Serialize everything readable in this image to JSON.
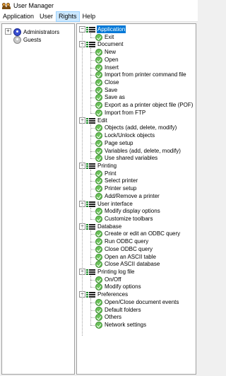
{
  "window": {
    "title": "User Manager"
  },
  "menu": [
    {
      "label": "Application",
      "active": false
    },
    {
      "label": "User",
      "active": false
    },
    {
      "label": "Rights",
      "active": true
    },
    {
      "label": "Help",
      "active": false
    }
  ],
  "users": [
    {
      "label": "Administrators",
      "type": "admin"
    },
    {
      "label": "Guests",
      "type": "guest"
    }
  ],
  "rights": [
    {
      "group": "Application",
      "selected": true,
      "items": [
        "Exit"
      ]
    },
    {
      "group": "Document",
      "items": [
        "New",
        "Open",
        "Insert",
        "Import from printer command file",
        "Close",
        "Save",
        "Save as",
        "Export as a printer object file (POF)",
        "Import from FTP"
      ]
    },
    {
      "group": "Edit",
      "items": [
        "Objects (add, delete, modify)",
        "Lock/Unlock objects",
        "Page setup",
        "Variables (add, delete, modify)",
        "Use shared variables"
      ]
    },
    {
      "group": "Printing",
      "items": [
        "Print",
        "Select printer",
        "Printer setup",
        "Add/Remove a printer"
      ]
    },
    {
      "group": "User interface",
      "items": [
        "Modify display options",
        "Customize toolbars"
      ]
    },
    {
      "group": "Database",
      "items": [
        "Create or edit an ODBC query",
        "Run ODBC query",
        "Close ODBC query",
        "Open an ASCII table",
        "Close ASCII database"
      ]
    },
    {
      "group": "Printing log file",
      "items": [
        "On/Off",
        "Modify options"
      ]
    },
    {
      "group": "Preferences",
      "items": [
        "Open/Close document events",
        "Default folders",
        "Others",
        "Network settings"
      ]
    }
  ],
  "icons": {
    "expander": "minus-box-icon",
    "group": "rights-group-icon",
    "check": "checkmark-icon"
  },
  "colors": {
    "selection": "#0078d7",
    "check": "#6ac259",
    "menu_active": "#cce8ff"
  }
}
